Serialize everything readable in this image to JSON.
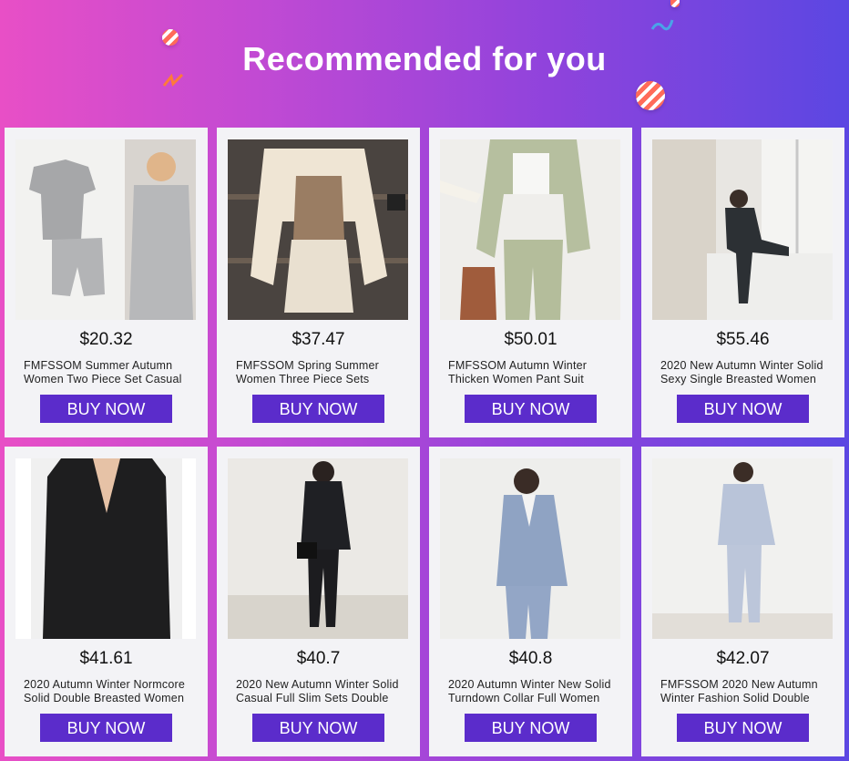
{
  "header": {
    "title": "Recommended for you"
  },
  "colors": {
    "button": "#5b2ccb",
    "card_bg": "#f3f3f6"
  },
  "products": [
    {
      "price": "$20.32",
      "name_line1": "FMFSSOM Summer Autumn",
      "name_line2": "Women Two Piece Set Casual",
      "button": "BUY NOW",
      "image": "grey-top-shorts-set"
    },
    {
      "price": "$37.47",
      "name_line1": "FMFSSOM Spring Summer",
      "name_line2": "Women Three Piece Sets",
      "button": "BUY NOW",
      "image": "plaid-shirt-shorts-set"
    },
    {
      "price": "$50.01",
      "name_line1": "FMFSSOM Autumn Winter",
      "name_line2": "Thicken Women Pant Suit",
      "button": "BUY NOW",
      "image": "sage-pant-suit"
    },
    {
      "price": "$55.46",
      "name_line1": "2020 New Autumn Winter Solid",
      "name_line2": "Sexy Single Breasted Women",
      "button": "BUY NOW",
      "image": "dark-suit-window"
    },
    {
      "price": "$41.61",
      "name_line1": "2020 Autumn Winter Normcore",
      "name_line2": "Solid Double Breasted Women",
      "button": "BUY NOW",
      "image": "black-blazer"
    },
    {
      "price": "$40.7",
      "name_line1": "2020 New Autumn Winter Solid",
      "name_line2": "Casual Full Slim Sets Double",
      "button": "BUY NOW",
      "image": "black-suit-set"
    },
    {
      "price": "$40.8",
      "name_line1": "2020 Autumn Winter New Solid",
      "name_line2": "Turndown Collar Full Women",
      "button": "BUY NOW",
      "image": "blue-suit-set"
    },
    {
      "price": "$42.07",
      "name_line1": "FMFSSOM 2020 New Autumn",
      "name_line2": "Winter Fashion Solid Double",
      "button": "BUY NOW",
      "image": "light-blue-suit-set"
    }
  ]
}
